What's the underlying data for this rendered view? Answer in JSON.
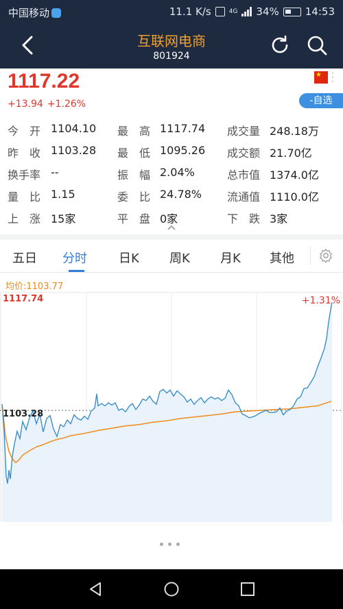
{
  "status_bar": {
    "carrier": "中国移动",
    "net_speed": "11.1 K/s",
    "network": "4G",
    "battery": "34%",
    "time": "14:53"
  },
  "header": {
    "title": "互联网电商",
    "code": "801924",
    "back_icon": "chevron-left-icon",
    "refresh_icon": "refresh-icon",
    "search_icon": "search-icon"
  },
  "quote": {
    "price": "1117.22",
    "change": "+13.94",
    "change_pct": "+1.26%",
    "favorite_label": "-自选",
    "flag_icon": "china-flag-icon",
    "color_up": "#e0362c"
  },
  "stats": {
    "open": {
      "label": "今　开",
      "value": "1104.10"
    },
    "high": {
      "label": "最　高",
      "value": "1117.74"
    },
    "volume": {
      "label": "成交量",
      "value": "248.18万"
    },
    "prev_close": {
      "label": "昨　收",
      "value": "1103.28"
    },
    "low": {
      "label": "最　低",
      "value": "1095.26"
    },
    "turnover": {
      "label": "成交额",
      "value": "21.70亿"
    },
    "turnover_rate": {
      "label": "换手率",
      "value": "--"
    },
    "amplitude": {
      "label": "振　幅",
      "value": "2.04%"
    },
    "market_cap": {
      "label": "总市值",
      "value": "1374.0亿"
    },
    "volume_ratio": {
      "label": "量　比",
      "value": "1.15"
    },
    "commission_ratio": {
      "label": "委　比",
      "value": "24.78%"
    },
    "float_cap": {
      "label": "流通值",
      "value": "1110.0亿"
    },
    "advancing": {
      "label": "上　涨",
      "value": "15家"
    },
    "unchanged": {
      "label": "平　盘",
      "value": "0家"
    },
    "declining": {
      "label": "下　跌",
      "value": "3家"
    }
  },
  "tabs": [
    "五日",
    "分时",
    "日K",
    "周K",
    "月K",
    "其他"
  ],
  "active_tab": "分时",
  "chart_labels": {
    "avg_price": "均价:1103.77",
    "max_value": "1117.74",
    "pct_value": "+1.31%",
    "base_value": "1103.28"
  },
  "chart_data": {
    "type": "line",
    "ylim": [
      1089.0,
      1118.5
    ],
    "baseline": 1103.28,
    "series": [
      {
        "color": "#3a8ec8",
        "x": [
          0,
          3,
          6,
          8,
          10,
          12,
          15,
          18,
          22,
          26,
          30,
          35,
          40,
          45,
          50,
          55,
          60,
          65,
          70,
          75,
          80,
          85,
          90,
          95,
          100,
          105,
          110,
          115,
          120,
          125,
          130,
          135,
          138,
          140,
          145,
          150,
          155,
          160,
          165,
          170,
          175,
          180,
          185,
          190,
          195,
          200,
          205,
          210,
          215,
          220,
          225,
          230,
          235,
          240,
          245,
          250,
          255,
          260,
          265,
          270,
          275,
          280,
          285,
          290,
          295,
          300,
          305,
          310,
          315,
          320,
          325,
          330,
          335,
          340,
          345,
          350,
          355,
          360,
          365,
          370,
          375,
          380,
          385,
          390,
          395,
          400,
          405,
          410,
          415,
          420,
          425,
          430,
          435,
          440,
          445,
          450,
          455,
          460,
          465,
          470,
          473,
          476,
          479,
          481
        ],
        "values": [
          1104.1,
          1100.5,
          1094.5,
          1093.5,
          1095.3,
          1094.1,
          1097.2,
          1098.8,
          1100.5,
          1099.5,
          1101.8,
          1100.7,
          1102.3,
          1103.2,
          1101.5,
          1102.8,
          1100.4,
          1102.2,
          1102.6,
          1100.8,
          1099.8,
          1101.4,
          1101.1,
          1102.0,
          1101.5,
          1102.7,
          1102.2,
          1102.0,
          1102.5,
          1102.1,
          1103.2,
          1103.6,
          1105.5,
          1103.9,
          1104.2,
          1103.9,
          1104.3,
          1104.0,
          1104.3,
          1103.3,
          1103.5,
          1103.1,
          1103.8,
          1104.2,
          1103.4,
          1104.0,
          1104.8,
          1104.6,
          1105.2,
          1104.5,
          1104.1,
          1105.8,
          1106.1,
          1105.6,
          1106.0,
          1105.2,
          1105.9,
          1105.5,
          1105.1,
          1104.4,
          1104.8,
          1104.1,
          1104.6,
          1105.0,
          1104.3,
          1104.8,
          1105.1,
          1104.8,
          1105.0,
          1104.6,
          1104.9,
          1106.0,
          1105.4,
          1104.3,
          1103.9,
          1102.8,
          1102.6,
          1102.3,
          1102.4,
          1102.6,
          1102.9,
          1103.1,
          1103.3,
          1103.0,
          1103.0,
          1103.1,
          1103.6,
          1102.7,
          1103.2,
          1103.4,
          1103.9,
          1104.8,
          1105.1,
          1106.2,
          1106.3,
          1107.0,
          1107.8,
          1109.1,
          1110.3,
          1111.6,
          1112.9,
          1115.1,
          1116.8,
          1117.74
        ]
      },
      {
        "color": "#f08a18",
        "x": [
          0,
          5,
          10,
          15,
          20,
          25,
          30,
          40,
          50,
          60,
          70,
          80,
          90,
          100,
          120,
          140,
          160,
          180,
          200,
          220,
          240,
          260,
          280,
          300,
          320,
          340,
          360,
          380,
          400,
          420,
          440,
          460,
          480
        ],
        "values": [
          1104.1,
          1099.8,
          1097.8,
          1096.8,
          1096.3,
          1096.7,
          1097.3,
          1097.9,
          1098.4,
          1098.7,
          1099.1,
          1099.4,
          1099.6,
          1099.9,
          1100.2,
          1100.6,
          1100.9,
          1101.2,
          1101.4,
          1101.7,
          1101.9,
          1102.2,
          1102.4,
          1102.6,
          1102.8,
          1103.1,
          1103.2,
          1103.3,
          1103.4,
          1103.5,
          1103.7,
          1103.9,
          1104.5
        ]
      }
    ]
  }
}
